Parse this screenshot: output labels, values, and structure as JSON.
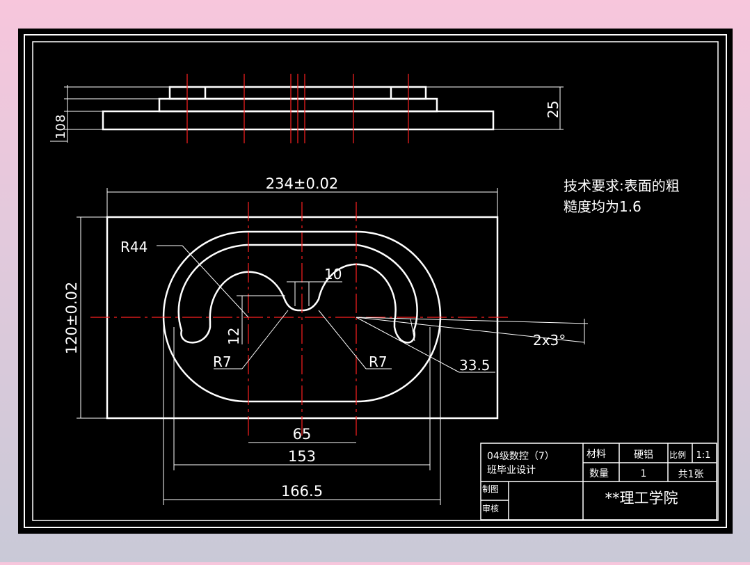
{
  "drawing": {
    "front_view": {
      "dim_total_height": "25",
      "dim_step_a": "8",
      "dim_step_b": "10"
    },
    "plan_view": {
      "dim_length": "234±0.02",
      "dim_width": "120±0.02",
      "dim_r44": "R44",
      "dim_10": "10",
      "dim_12": "12",
      "dim_r7_left": "R7",
      "dim_r7_right": "R7",
      "dim_2x3": "2x3°",
      "dim_33_5": "33.5",
      "dim_65": "65",
      "dim_153": "153",
      "dim_166_5": "166.5"
    },
    "tech_requirements": {
      "line1": "技术要求:表面的粗",
      "line2": "糙度均为1.6"
    },
    "title_block": {
      "project_line1": "04级数控（7）",
      "project_line2": "班毕业设计",
      "material_label": "材料",
      "material_value": "硬铝",
      "scale_label": "比例",
      "scale_value": "1:1",
      "quantity_label": "数量",
      "quantity_value": "1",
      "sheets": "共1张",
      "drawn_label": "制图",
      "checked_label": "审核",
      "institution": "**理工学院"
    }
  },
  "colors": {
    "background": "#000000",
    "line": "#ffffff",
    "centerline": "#ff2020"
  }
}
